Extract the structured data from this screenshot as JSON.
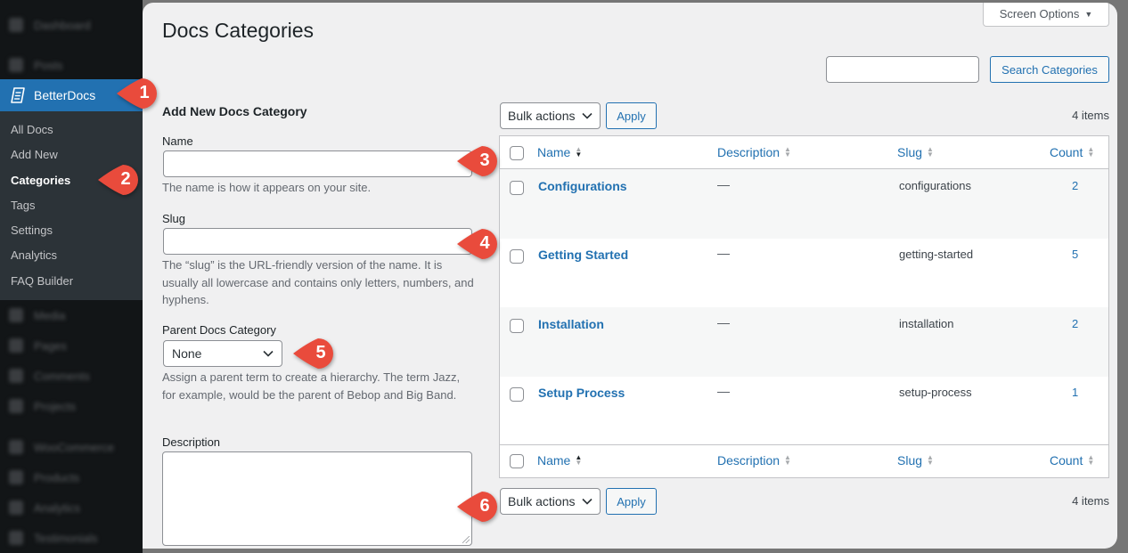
{
  "sidebar": {
    "blurred_top": [
      "Dashboard",
      "Posts"
    ],
    "active": "BetterDocs",
    "submenu": [
      {
        "label": "All Docs",
        "current": false
      },
      {
        "label": "Add New",
        "current": false
      },
      {
        "label": "Categories",
        "current": true
      },
      {
        "label": "Tags",
        "current": false
      },
      {
        "label": "Settings",
        "current": false
      },
      {
        "label": "Analytics",
        "current": false
      },
      {
        "label": "FAQ Builder",
        "current": false
      }
    ],
    "blurred_bottom": [
      "Media",
      "Pages",
      "Comments",
      "Projects",
      "WooCommerce",
      "Products",
      "Analytics",
      "Testimonials"
    ]
  },
  "header": {
    "title": "Docs Categories",
    "screen_options": "Screen Options",
    "search_value": "",
    "search_button": "Search Categories"
  },
  "form": {
    "title": "Add New Docs Category",
    "name_label": "Name",
    "name_value": "",
    "name_help": "The name is how it appears on your site.",
    "slug_label": "Slug",
    "slug_value": "",
    "slug_help": "The “slug” is the URL-friendly version of the name. It is usually all lowercase and contains only letters, numbers, and hyphens.",
    "parent_label": "Parent Docs Category",
    "parent_value": "None",
    "parent_help": "Assign a parent term to create a hierarchy. The term Jazz, for example, would be the parent of Bebop and Big Band.",
    "description_label": "Description",
    "description_value": ""
  },
  "table": {
    "bulk_actions": "Bulk actions",
    "apply": "Apply",
    "items_count": "4 items",
    "columns": [
      "Name",
      "Description",
      "Slug",
      "Count"
    ],
    "rows": [
      {
        "name": "Configurations",
        "description": "—",
        "slug": "configurations",
        "count": "2"
      },
      {
        "name": "Getting Started",
        "description": "—",
        "slug": "getting-started",
        "count": "5"
      },
      {
        "name": "Installation",
        "description": "—",
        "slug": "installation",
        "count": "2"
      },
      {
        "name": "Setup Process",
        "description": "—",
        "slug": "setup-process",
        "count": "1"
      }
    ]
  },
  "callouts": [
    "1",
    "2",
    "3",
    "4",
    "5",
    "6"
  ],
  "colors": {
    "accent": "#2271b1",
    "callout": "#e94b3c",
    "sidebar_bg": "#121517",
    "submenu_bg": "#2c3338"
  }
}
